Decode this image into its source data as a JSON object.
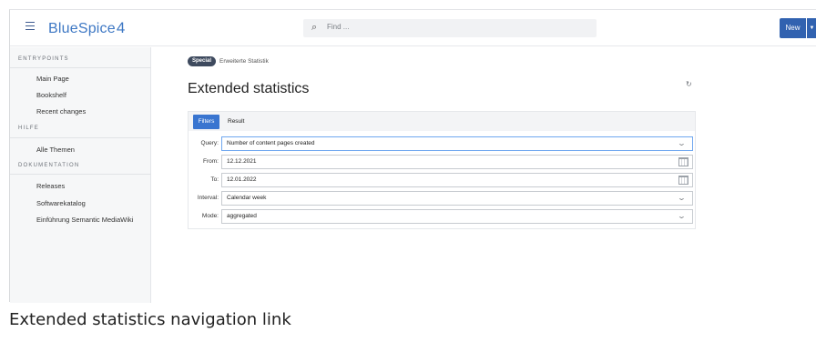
{
  "header": {
    "logo_text": "BlueSpice",
    "logo_mark": "4",
    "search_placeholder": "Find ...",
    "new_button": "New"
  },
  "sidebar": {
    "sections": [
      {
        "title": "ENTRYPOINTS",
        "items": [
          "Main Page",
          "Bookshelf",
          "Recent changes"
        ]
      },
      {
        "title": "HILFE",
        "items": [
          "Alle Themen"
        ]
      },
      {
        "title": "DOKUMENTATION",
        "items": [
          "Releases",
          "Softwarekatalog",
          "Einführung Semantic MediaWiki"
        ]
      }
    ]
  },
  "main": {
    "breadcrumb_badge": "Special",
    "breadcrumb_text": "Erweiterte Statistik",
    "title": "Extended statistics",
    "tabs": [
      "Filters",
      "Result"
    ],
    "fields": {
      "query": {
        "label": "Query:",
        "value": "Number of content pages created"
      },
      "from": {
        "label": "From:",
        "value": "12.12.2021"
      },
      "to": {
        "label": "To:",
        "value": "12.01.2022"
      },
      "interval": {
        "label": "Interval:",
        "value": "Calendar week"
      },
      "mode": {
        "label": "Mode:",
        "value": "aggregated"
      }
    }
  },
  "caption": "Extended statistics navigation link",
  "colors": {
    "accent": "#3162b0",
    "tab_active": "#3975d0",
    "logo": "#3e78c4"
  }
}
